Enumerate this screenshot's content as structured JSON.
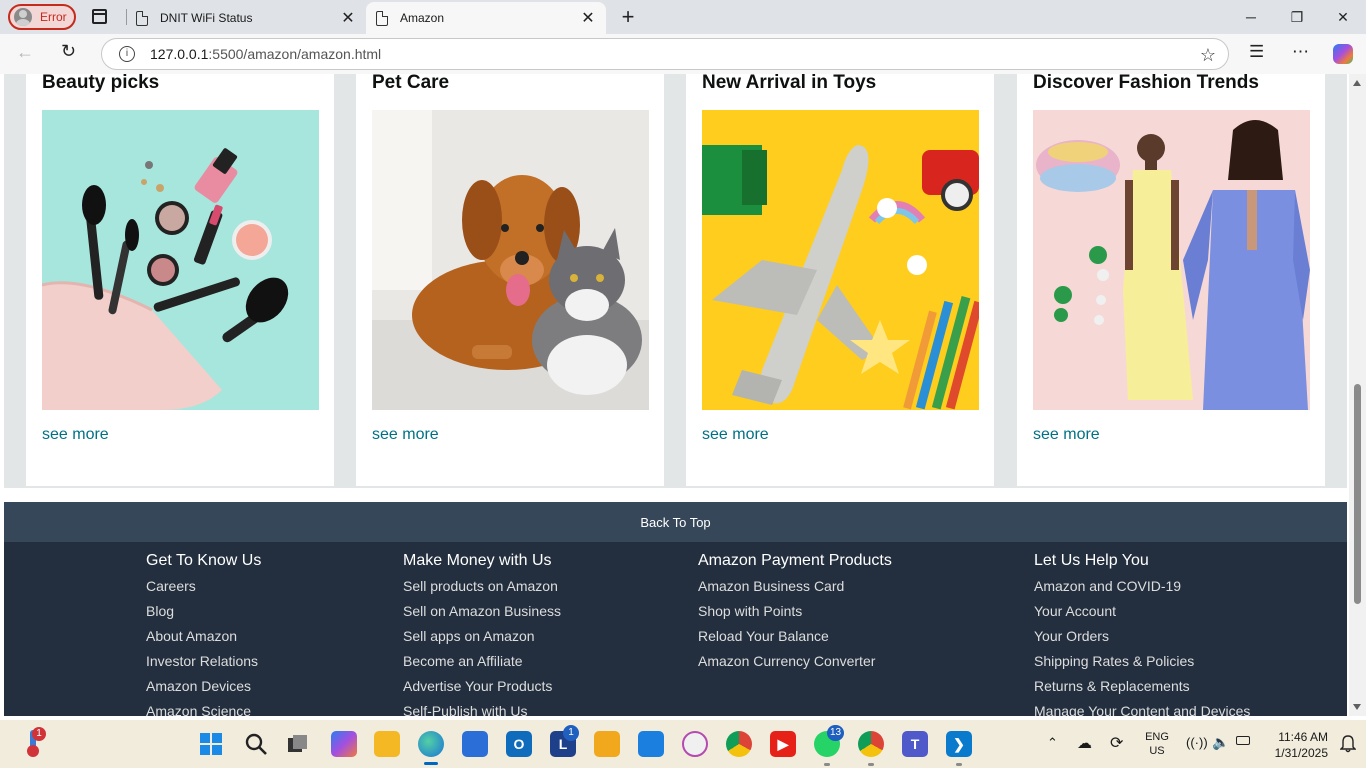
{
  "browser": {
    "profile_status": "Error",
    "tabs": [
      {
        "title": "DNIT WiFi Status",
        "active": false
      },
      {
        "title": "Amazon",
        "active": true
      }
    ],
    "url_host": "127.0.0.1",
    "url_path": ":5500/amazon/amazon.html"
  },
  "cards": [
    {
      "title": "Beauty picks",
      "link": "see more",
      "image": "beauty-products"
    },
    {
      "title": "Pet Care",
      "link": "see more",
      "image": "dog-and-cat"
    },
    {
      "title": "New Arrival in Toys",
      "link": "see more",
      "image": "toy-airplane"
    },
    {
      "title": "Discover Fashion Trends",
      "link": "see more",
      "image": "fashion-models"
    }
  ],
  "back_to_top": "Back To Top",
  "footer": {
    "columns": [
      {
        "heading": "Get To Know Us",
        "links": [
          "Careers",
          "Blog",
          "About Amazon",
          "Investor Relations",
          "Amazon Devices",
          "Amazon Science"
        ]
      },
      {
        "heading": "Make Money with Us",
        "links": [
          "Sell products on Amazon",
          "Sell on Amazon Business",
          "Sell apps on Amazon",
          "Become an Affiliate",
          "Advertise Your Products",
          "Self-Publish with Us"
        ]
      },
      {
        "heading": "Amazon Payment Products",
        "links": [
          "Amazon Business Card",
          "Shop with Points",
          "Reload Your Balance",
          "Amazon Currency Converter"
        ]
      },
      {
        "heading": "Let Us Help You",
        "links": [
          "Amazon and COVID-19",
          "Your Account",
          "Your Orders",
          "Shipping Rates & Policies",
          "Returns & Replacements",
          "Manage Your Content and Devices"
        ]
      }
    ]
  },
  "taskbar": {
    "weather_badge": "1",
    "mail_badge": "1",
    "whatsapp_badge": "13",
    "language": "ENG",
    "region": "US",
    "time": "11:46 AM",
    "date": "1/31/2025"
  },
  "colors": {
    "link": "#007185",
    "footer_bg": "#232f3e",
    "back_to_top_bg": "#37475a",
    "page_gray": "#e3e6e6",
    "error_red": "#c42b1c"
  }
}
